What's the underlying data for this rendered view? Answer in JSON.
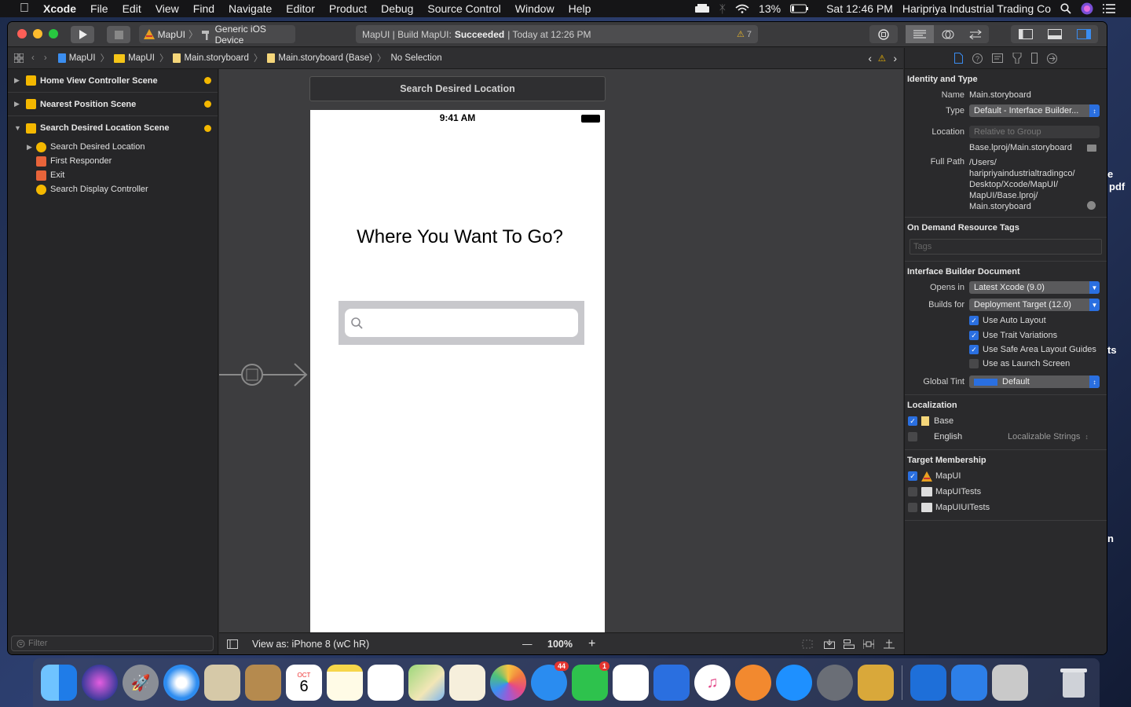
{
  "menubar": {
    "app": "Xcode",
    "items": [
      "File",
      "Edit",
      "View",
      "Find",
      "Navigate",
      "Editor",
      "Product",
      "Debug",
      "Source Control",
      "Window",
      "Help"
    ],
    "battery": "13%",
    "clock": "Sat 12:46 PM",
    "user": "Haripriya Industrial Trading Co"
  },
  "desktop": {
    "frag1": "e",
    "frag2": "pdf",
    "frag3": "ts",
    "frag4": "n"
  },
  "toolbar": {
    "scheme_project": "MapUI",
    "scheme_device": "Generic iOS Device",
    "activity_prefix": "MapUI | Build MapUI:",
    "activity_status": "Succeeded",
    "activity_time": "| Today at 12:26 PM",
    "warning_count": "7"
  },
  "jumpbar": {
    "crumbs": [
      "MapUI",
      "MapUI",
      "Main.storyboard",
      "Main.storyboard (Base)",
      "No Selection"
    ]
  },
  "navigator": {
    "scenes": [
      {
        "label": "Home View Controller Scene"
      },
      {
        "label": "Nearest Position Scene"
      },
      {
        "label": "Search Desired Location Scene"
      }
    ],
    "children": [
      "Search Desired Location",
      "First Responder",
      "Exit",
      "Search Display Controller"
    ],
    "filter_placeholder": "Filter"
  },
  "canvas": {
    "scene_title": "Search Desired Location",
    "status_time": "9:41 AM",
    "heading": "Where You Want To Go?",
    "view_as": "View as: iPhone 8 (",
    "size_class": "wC hR)",
    "zoom": "100%",
    "zoom_out": "—",
    "zoom_in": "+"
  },
  "inspector": {
    "identity_title": "Identity and Type",
    "name_label": "Name",
    "name_value": "Main.storyboard",
    "type_label": "Type",
    "type_value": "Default - Interface Builder...",
    "location_label": "Location",
    "location_value": "Relative to Group",
    "location_path": "Base.lproj/Main.storyboard",
    "fullpath_label": "Full Path",
    "fullpath_lines": [
      "/Users/",
      "haripriyaindustrialtradingco/",
      "Desktop/Xcode/MapUI/",
      "MapUI/Base.lproj/",
      "Main.storyboard"
    ],
    "tags_title": "On Demand Resource Tags",
    "tags_placeholder": "Tags",
    "ibdoc_title": "Interface Builder Document",
    "opens_label": "Opens in",
    "opens_value": "Latest Xcode (9.0)",
    "builds_label": "Builds for",
    "builds_value": "Deployment Target (12.0)",
    "checks": [
      {
        "label": "Use Auto Layout",
        "checked": true
      },
      {
        "label": "Use Trait Variations",
        "checked": true
      },
      {
        "label": "Use Safe Area Layout Guides",
        "checked": true
      },
      {
        "label": "Use as Launch Screen",
        "checked": false
      }
    ],
    "tint_label": "Global Tint",
    "tint_value": "Default",
    "localization_title": "Localization",
    "loc_base": "Base",
    "loc_english": "English",
    "loc_english_value": "Localizable Strings",
    "target_title": "Target Membership",
    "targets": [
      {
        "label": "MapUI",
        "checked": true
      },
      {
        "label": "MapUITests",
        "checked": false
      },
      {
        "label": "MapUIUITests",
        "checked": false
      }
    ]
  },
  "dock": {
    "calendar_month": "OCT",
    "calendar_day": "6",
    "messages_badge": "44",
    "facetime_badge": "1"
  },
  "colors": {
    "accent": "#2a6fe0",
    "warning": "#f4b800"
  }
}
